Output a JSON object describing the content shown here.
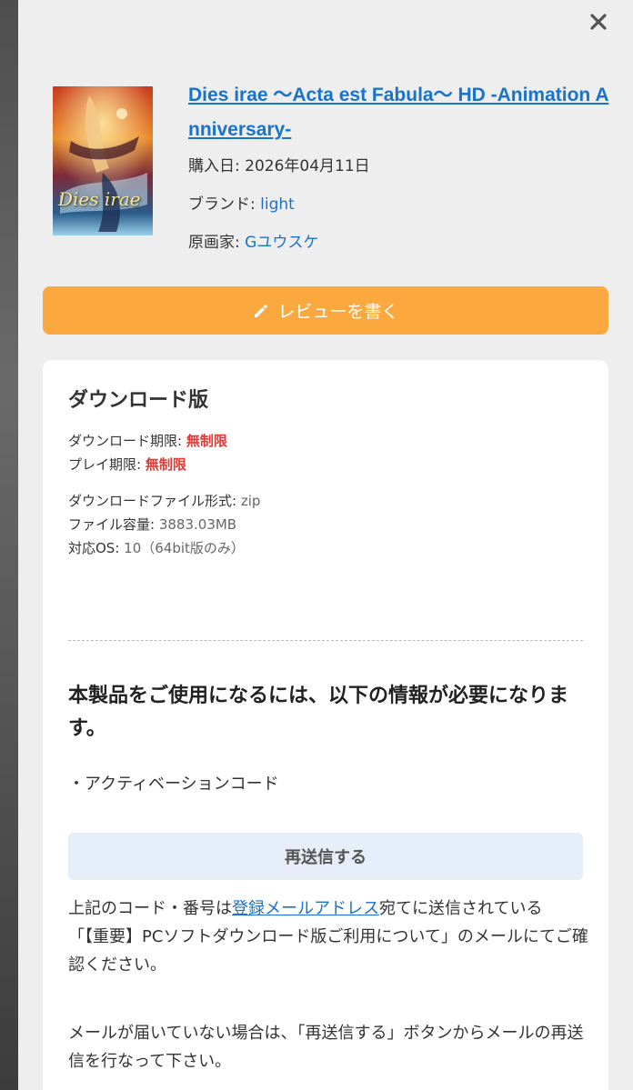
{
  "modal": {
    "close_label": "×"
  },
  "product": {
    "title": "Dies irae 〜Acta est Fabula〜 HD -Animation Anniversary-",
    "purchase_label": "購入日: ",
    "purchase_date": "2026年04月11日",
    "brand_label": "ブランド: ",
    "brand": "light",
    "artist_label": "原画家: ",
    "artist": "Gユウスケ",
    "cover_text": "Dies irae"
  },
  "review_button": {
    "label": "レビューを書く",
    "icon": "pencil-icon"
  },
  "download_card": {
    "title": "ダウンロード版",
    "specs": [
      {
        "label": "ダウンロード期限: ",
        "value": "無制限",
        "highlight": true
      },
      {
        "label": "プレイ期限: ",
        "value": "無制限",
        "highlight": true
      },
      {
        "label": "ダウンロードファイル形式: ",
        "value": "zip",
        "highlight": false
      },
      {
        "label": "ファイル容量: ",
        "value": "3883.03MB",
        "highlight": false
      },
      {
        "label": "対応OS: ",
        "value": "10（64bit版のみ）",
        "highlight": false
      }
    ],
    "requirement_title": "本製品をご使用になるには、以下の情報が必要になります。",
    "requirement_item": "・アクティベーションコード",
    "resend_label": "再送信する",
    "note1_prefix": "上記のコード・番号は",
    "note1_link": "登録メールアドレス",
    "note1_suffix": "宛てに送信されている",
    "note1_line2": "「【重要】PCソフトダウンロード版ご利用について」のメールにてご確認ください。",
    "note2": "メールが届いていない場合は、「再送信する」ボタンからメールの再送信を行なって下さい。"
  },
  "colors": {
    "accent_orange": "#fba93e",
    "link_blue": "#1a73c9",
    "alert_red": "#e53935",
    "resend_bg": "#e6eef9"
  }
}
